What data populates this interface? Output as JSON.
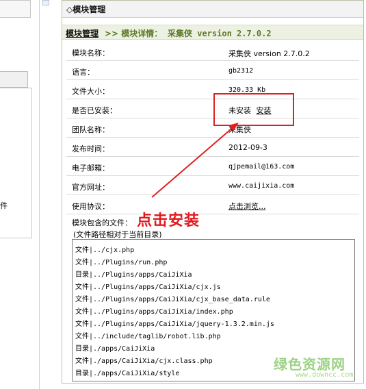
{
  "sidebar": {
    "partial_label": "件"
  },
  "panel": {
    "title": "◇模块管理",
    "breadcrumb": {
      "root": "模块管理",
      "arrow_label": ">> 模块详情：",
      "module": "采集侠 version 2.7.0.2"
    }
  },
  "details": [
    {
      "label": "模块名称：",
      "value": "采集侠 version 2.7.0.2"
    },
    {
      "label": "语言：",
      "value": "gb2312"
    },
    {
      "label": "文件大小：",
      "value": "320.33 Kb"
    },
    {
      "label": "是否已安装：",
      "value": "未安装",
      "action": "安装"
    },
    {
      "label": "团队名称：",
      "value": "采集侠"
    },
    {
      "label": "发布时间：",
      "value": "2012-09-3"
    },
    {
      "label": "电子邮箱：",
      "value": "qjpemail@163.com"
    },
    {
      "label": "官方网址：",
      "value": "www.caijixia.com"
    },
    {
      "label": "使用协议：",
      "value": "点击浏览..."
    }
  ],
  "files": {
    "label": "模块包含的文件：",
    "note": "(文件路径相对于当前目录)",
    "items": [
      "文件|../cjx.php",
      "文件|../Plugins/run.php",
      "目录|../Plugins/apps/CaiJiXia",
      "文件|../Plugins/apps/CaiJiXia/cjx.js",
      "文件|../Plugins/apps/CaiJiXia/cjx_base_data.rule",
      "文件|../Plugins/apps/CaiJiXia/index.php",
      "文件|../Plugins/apps/CaiJiXia/jquery-1.3.2.min.js",
      "文件|../include/taglib/robot.lib.php",
      "目录|./apps/CaiJiXia",
      "文件|./apps/CaiJiXia/cjx.class.php",
      "目录|./apps/CaiJiXia/style"
    ]
  },
  "annotation": {
    "text": "点击安装",
    "color": "#e3171b"
  },
  "watermark": {
    "brand": "绿色资源网",
    "url": "www.downcc.com"
  }
}
